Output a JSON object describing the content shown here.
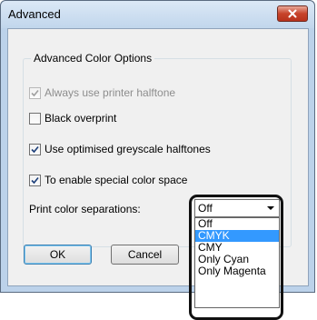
{
  "window": {
    "title": "Advanced"
  },
  "group": {
    "title": "Advanced Color Options"
  },
  "options": [
    {
      "label": "Always use printer halftone",
      "checked": true,
      "enabled": false
    },
    {
      "label": "Black overprint",
      "checked": false,
      "enabled": true
    },
    {
      "label": "Use optimised greyscale halftones",
      "checked": true,
      "enabled": true
    },
    {
      "label": "To enable special color space",
      "checked": true,
      "enabled": true
    }
  ],
  "separations": {
    "label": "Print color separations:",
    "selected_value": "Off",
    "items": [
      "Off",
      "CMYK",
      "CMY",
      "Only Cyan",
      "Only Magenta"
    ],
    "highlighted_item": "CMYK"
  },
  "buttons": {
    "ok": "OK",
    "cancel": "Cancel"
  },
  "colors": {
    "selection": "#3399ff",
    "close_button": "#c7432a",
    "title_bar": "#c1d6ec"
  },
  "icons": {
    "close": "close-icon",
    "check": "checkmark-icon",
    "dropdown": "chevron-down-icon"
  }
}
